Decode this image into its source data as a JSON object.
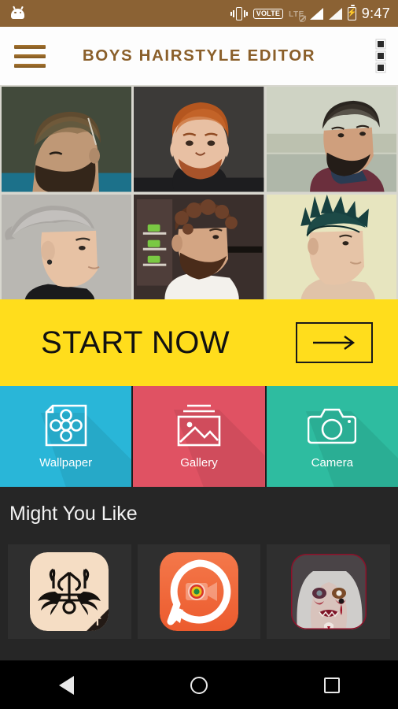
{
  "status_bar": {
    "background": "#8b6234",
    "left_icon": "android-head-icon",
    "icons": [
      "vibrate-icon",
      "volte-badge",
      "lte-disabled-icon",
      "signal-bars-icon",
      "signal-bars-2-icon",
      "battery-charging-icon"
    ],
    "volte_label": "VOLTE",
    "lte_label": "LTE",
    "battery_glyph": "⚡",
    "time": "9:47"
  },
  "appbar": {
    "menu_icon": "hamburger-menu-icon",
    "title": "BOYS HAIRSTYLE EDITOR",
    "title_color": "#8a5f2a",
    "overflow_icon": "overflow-menu-icon",
    "background": "#fdfdfd"
  },
  "photo_grid": {
    "background": "#d8d7cf",
    "items": [
      {
        "name": "hairstyle-photo-1",
        "alt": "man with slicked side-part pompadour and full beard",
        "bg": "#4a5243",
        "hair": "#6b5436",
        "skin": "#d9ab86",
        "beard": "#3b2a1d",
        "shirt": "#1f7f9c"
      },
      {
        "name": "hairstyle-photo-2",
        "alt": "ginger man with red quiff hair and red beard",
        "bg": "#3c3a38",
        "hair": "#b4561f",
        "skin": "#e8c0a3",
        "beard": "#a8532a",
        "shirt": "#1d1d1f"
      },
      {
        "name": "hairstyle-photo-3",
        "alt": "man with textured dark quiff and beard in sweater",
        "bg": "#cfd3c4",
        "hair": "#2a2520",
        "skin": "#cf9f7d",
        "beard": "#241d18",
        "shirt": "#6b2f3d"
      },
      {
        "name": "hairstyle-photo-4",
        "alt": "man with grey silver brushed-up hair and earring",
        "bg": "#b9b7b2",
        "hair": "#aaa7a3",
        "skin": "#e7c2a4",
        "beard": "#aaa7a3",
        "shirt": "#1a1a1c"
      },
      {
        "name": "hairstyle-photo-5",
        "alt": "man with curly brown hair and beard in barber shop",
        "bg": "#3a2f2c",
        "hair": "#5a3420",
        "skin": "#d3a583",
        "beard": "#4a2c1a",
        "shirt": "#f3f1ec"
      },
      {
        "name": "hairstyle-photo-6",
        "alt": "man with teal coloured spiked hair and undercut",
        "bg": "#e7e5bf",
        "hair": "#17403f",
        "skin": "#e6c4a7",
        "beard": "#e6c4a7",
        "shirt": "#e7e5bf"
      }
    ]
  },
  "start_banner": {
    "label": "START NOW",
    "background": "#ffdd1c",
    "arrow_icon": "arrow-right-icon"
  },
  "tiles": [
    {
      "name": "wallpaper",
      "label": "Wallpaper",
      "icon": "wallpaper-flower-icon",
      "color": "#29b6d8"
    },
    {
      "name": "gallery",
      "label": "Gallery",
      "icon": "gallery-image-icon",
      "color": "#e05263"
    },
    {
      "name": "camera",
      "label": "Camera",
      "icon": "camera-icon",
      "color": "#2ebca0"
    }
  ],
  "might_you_like": {
    "heading": "Might You Like",
    "background": "#262626",
    "cards": [
      {
        "name": "ad-tattoo-app",
        "alt": "tattoo design app icon with tribal anchor and wings",
        "letter": "T",
        "bg": "#f5ddc4",
        "art": "#14100d",
        "corner": "#231a15"
      },
      {
        "name": "ad-video-chat-app",
        "alt": "video chat app icon, orange with speech bubble and camcorder",
        "bg_top": "#f4784a",
        "bg_bottom": "#ec5b2e",
        "ring": "#ffffff",
        "lens_outer": "#d9352a",
        "lens_mid": "#e8c11c",
        "lens_inner": "#1e8a44"
      },
      {
        "name": "ad-zombie-makeup-app",
        "alt": "zombie horror makeup selfie app icon",
        "border": "#8e0f28",
        "hair": "#cfcdcb",
        "skin": "#d8c3bc",
        "blood": "#9c1226"
      }
    ]
  },
  "navbar": {
    "background": "#000000",
    "buttons": [
      {
        "name": "nav-back-button",
        "icon": "back-triangle-icon"
      },
      {
        "name": "nav-home-button",
        "icon": "home-circle-icon"
      },
      {
        "name": "nav-recents-button",
        "icon": "recents-square-icon"
      }
    ]
  }
}
